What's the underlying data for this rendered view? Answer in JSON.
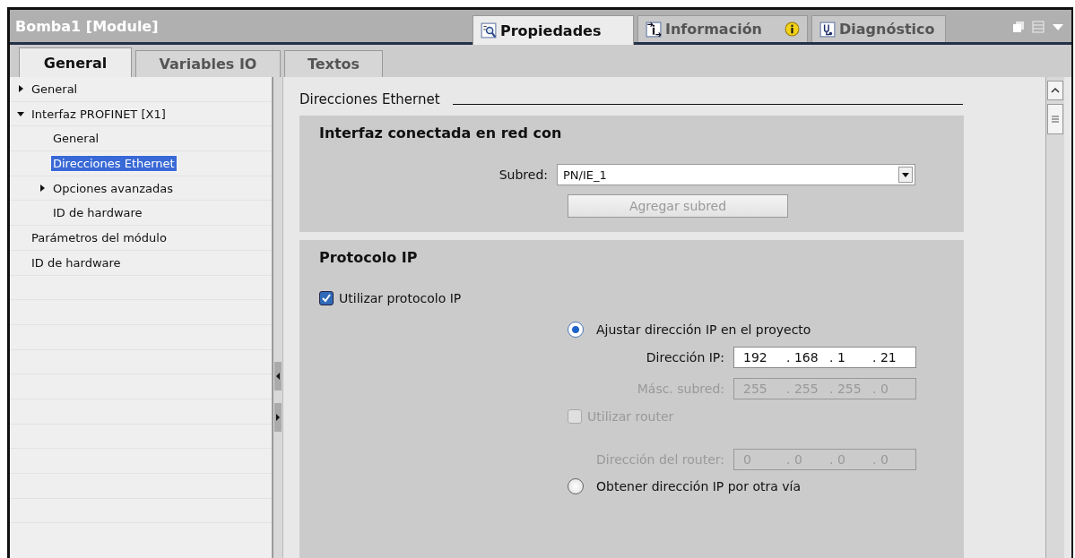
{
  "window": {
    "title": "Bomba1 [Module]"
  },
  "inspector_tabs": [
    {
      "label": "Propiedades",
      "selected": true,
      "kind": "properties",
      "alert": false
    },
    {
      "label": "Información",
      "selected": false,
      "kind": "info",
      "alert": true
    },
    {
      "label": "Diagnóstico",
      "selected": false,
      "kind": "diagnostics",
      "alert": false
    }
  ],
  "tabs": [
    {
      "label": "General",
      "selected": true
    },
    {
      "label": "Variables IO",
      "selected": false
    },
    {
      "label": "Textos",
      "selected": false
    }
  ],
  "tree": [
    {
      "label": "General",
      "kind": "branch",
      "expanded": false,
      "selected": false
    },
    {
      "label": "Interfaz PROFINET [X1]",
      "kind": "branch",
      "expanded": true,
      "selected": false,
      "children": [
        {
          "label": "General",
          "kind": "leaf",
          "selected": false
        },
        {
          "label": "Direcciones Ethernet",
          "kind": "leaf",
          "selected": true
        },
        {
          "label": "Opciones avanzadas",
          "kind": "branch",
          "expanded": false,
          "selected": false
        },
        {
          "label": "ID de hardware",
          "kind": "leaf",
          "selected": false
        }
      ]
    },
    {
      "label": "Parámetros del módulo",
      "kind": "leaf",
      "selected": false
    },
    {
      "label": "ID de hardware",
      "kind": "leaf",
      "selected": false
    }
  ],
  "section_title": "Direcciones Ethernet",
  "network_group": {
    "title": "Interfaz conectada en red con",
    "subnet_label": "Subred:",
    "subnet_value": "PN/IE_1",
    "add_button": {
      "label": "Agregar subred",
      "disabled": true
    }
  },
  "ip_group": {
    "title": "Protocolo IP",
    "use_ip": {
      "label": "Utilizar protocolo IP",
      "checked": true
    },
    "options": [
      {
        "label": "Ajustar dirección IP en el proyecto",
        "selected": true
      },
      {
        "label": "Obtener dirección IP por otra vía",
        "selected": false
      }
    ],
    "ip_address": {
      "label": "Dirección IP:",
      "octets": [
        "192",
        ". 168",
        ". 1",
        ". 21"
      ],
      "disabled": false
    },
    "subnet_mask": {
      "label": "Másc. subred:",
      "octets": [
        "255",
        ". 255",
        ". 255",
        ". 0"
      ],
      "disabled": true
    },
    "use_router": {
      "label": "Utilizar router",
      "checked": false,
      "disabled": true
    },
    "router_address": {
      "label": "Dirección del router:",
      "octets": [
        "0",
        ". 0",
        ". 0",
        ". 0"
      ],
      "disabled": true
    }
  }
}
